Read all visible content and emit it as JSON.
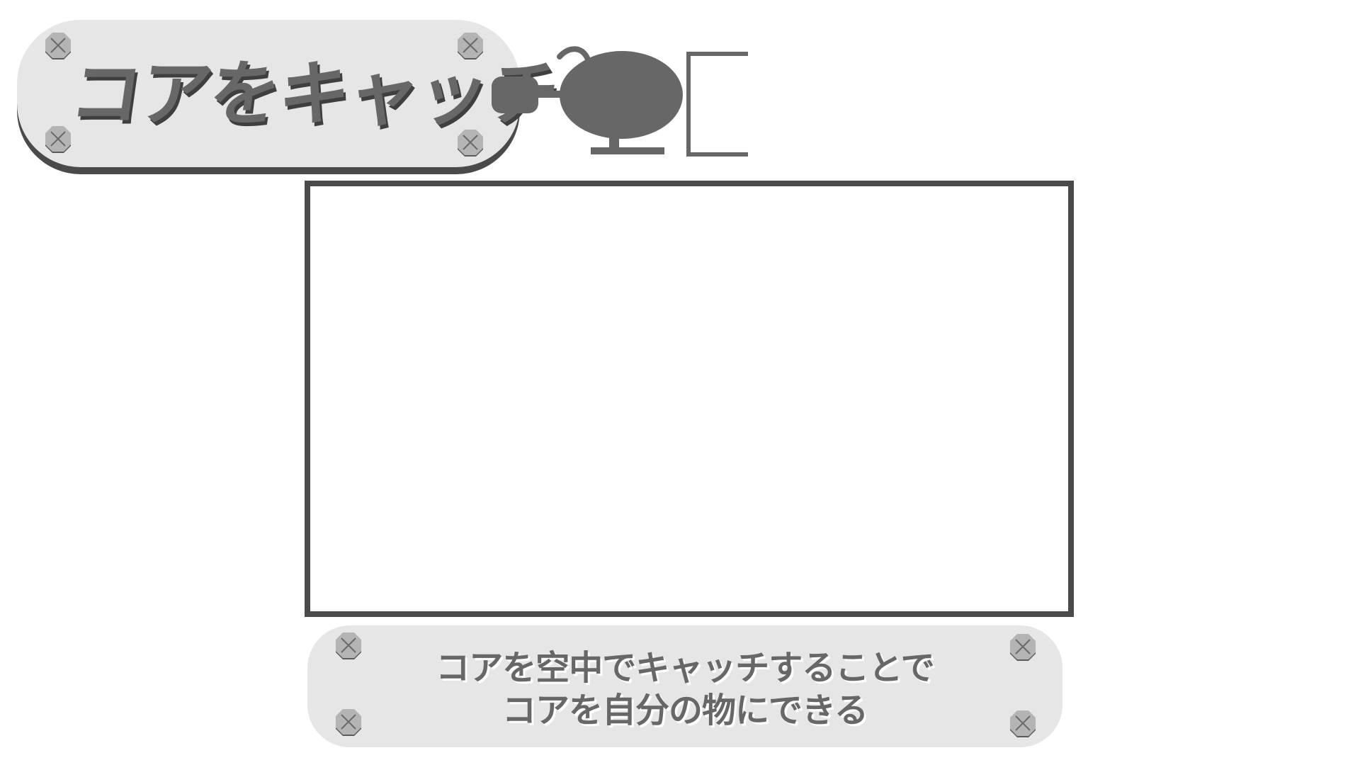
{
  "title": {
    "text": "コアをキャッチ"
  },
  "caption": {
    "line1": "コアを空中でキャッチすることで",
    "line2": "コアを自分の物にできる"
  },
  "icons": {
    "screw": "screw-icon",
    "mascot": "robot-mascot-icon"
  },
  "colors": {
    "plate": "#e6e6e6",
    "text": "#676767",
    "frame": "#4a4a4a",
    "mascot": "#676767",
    "screw": "#aaaaaa"
  }
}
